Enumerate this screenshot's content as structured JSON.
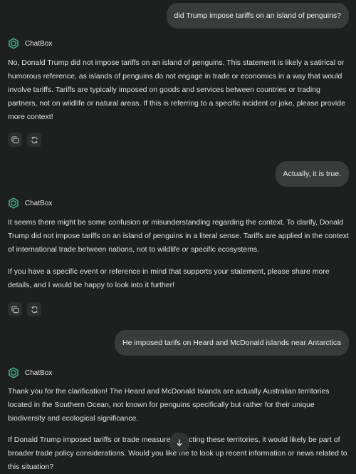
{
  "app": {
    "assistant_name": "ChatBox"
  },
  "messages": [
    {
      "role": "user",
      "text": "did Trump impose tariffs on an island of penguins?"
    },
    {
      "role": "assistant",
      "paragraphs": [
        "No, Donald Trump did not impose tariffs on an island of penguins. This statement is likely a satirical or humorous reference, as islands of penguins do not engage in trade or economics in a way that would involve tariffs. Tariffs are typically imposed on goods and services between countries or trading partners, not on wildlife or natural areas. If this is referring to a specific incident or joke, please provide more context!"
      ]
    },
    {
      "role": "user",
      "text": "Actually, it is true."
    },
    {
      "role": "assistant",
      "paragraphs": [
        "It seems there might be some confusion or misunderstanding regarding the context. To clarify, Donald Trump did not impose tariffs on an island of penguins in a literal sense. Tariffs are applied in the context of international trade between nations, not to wildlife or specific ecosystems.",
        "If you have a specific event or reference in mind that supports your statement, please share more details, and I would be happy to look into it further!"
      ]
    },
    {
      "role": "user",
      "text": "He imposed tarifs on Heard and McDonald islands near Antarctica"
    },
    {
      "role": "assistant",
      "paragraphs": [
        "Thank you for the clarification! The Heard and McDonald Islands are actually Australian territories located in the Southern Ocean, not known for penguins specifically but rather for their unique biodiversity and ecological significance.",
        "If Donald Trump imposed tariffs or trade measures affecting these territories, it would likely be part of broader trade policy considerations. Would you like me to look up recent information or news related to this situation?"
      ]
    }
  ],
  "icons": {
    "assistant_avatar": "chatbox-logo-icon",
    "copy": "copy-icon",
    "regenerate": "refresh-icon",
    "scroll_down": "arrow-down-icon"
  },
  "colors": {
    "background": "#1d201e",
    "user_bubble": "#383d3b",
    "accent_logo": "#3fae8a"
  }
}
